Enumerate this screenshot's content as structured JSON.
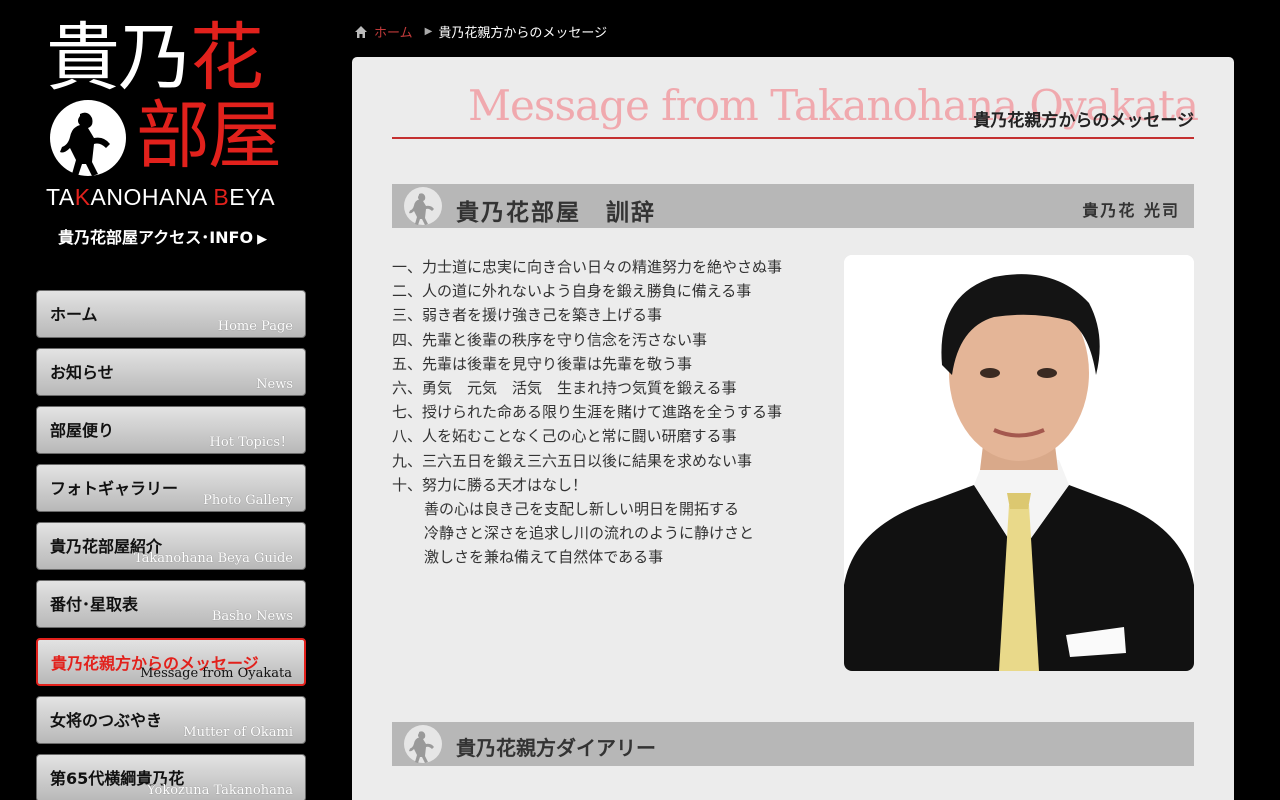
{
  "logo": {
    "line1_white": "貴乃",
    "line1_red": "花",
    "line2": "部屋",
    "en_parts": [
      "TA",
      "K",
      "ANOHANA ",
      "B",
      "EYA"
    ]
  },
  "access_link": "貴乃花部屋アクセス･INFO",
  "nav": [
    {
      "ja": "ホーム",
      "en": "Home Page"
    },
    {
      "ja": "お知らせ",
      "en": "News"
    },
    {
      "ja": "部屋便り",
      "en": "Hot Topics！"
    },
    {
      "ja": "フォトギャラリー",
      "en": "Photo Gallery"
    },
    {
      "ja": "貴乃花部屋紹介",
      "en": "Takanohana Beya Guide"
    },
    {
      "ja": "番付･星取表",
      "en": "Basho News"
    },
    {
      "ja": "貴乃花親方からのメッセージ",
      "en": "Message from Oyakata"
    },
    {
      "ja": "女将のつぶやき",
      "en": "Mutter of Okami"
    },
    {
      "ja": "第65代横綱貴乃花",
      "en": "Yokozuna Takanohana"
    }
  ],
  "breadcrumb": {
    "home": "ホーム",
    "current": "貴乃花親方からのメッセージ"
  },
  "page_title": {
    "en": "Message from Takanohana Oyakata",
    "ja": "貴乃花親方からのメッセージ"
  },
  "kunji": {
    "title": "貴乃花部屋　訓辞",
    "author": "貴乃花 光司",
    "rules": [
      "一、力士道に忠実に向き合い日々の精進努力を絶やさぬ事",
      "二、人の道に外れないよう自身を鍛え勝負に備える事",
      "三、弱き者を援け強き己を築き上げる事",
      "四、先輩と後輩の秩序を守り信念を汚さない事",
      "五、先輩は後輩を見守り後輩は先輩を敬う事",
      "六、勇気　元気　活気　生まれ持つ気質を鍛える事",
      "七、授けられた命ある限り生涯を賭けて進路を全うする事",
      "八、人を妬むことなく己の心と常に闘い研磨する事",
      "九、三六五日を鍛え三六五日以後に結果を求めない事",
      "十、努力に勝る天才はなし！"
    ],
    "closing": [
      "善の心は良き己を支配し新しい明日を開拓する",
      "冷静さと深さを追求し川の流れのように静けさと",
      "激しさを兼ね備えて自然体である事"
    ]
  },
  "diary": {
    "title": "貴乃花親方ダイアリー"
  },
  "colors": {
    "accent_red": "#e2211c",
    "panel_bg": "#ececec",
    "section_bar": "#b7b7b7",
    "title_pink": "#f0a9ae"
  }
}
